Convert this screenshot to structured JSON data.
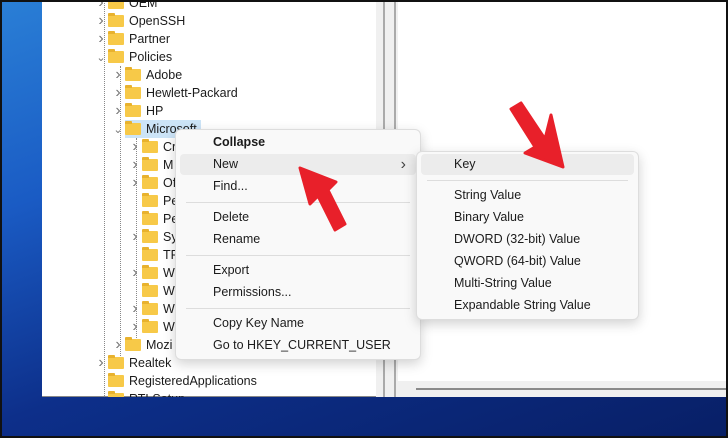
{
  "tree": [
    {
      "label": "OEM",
      "level": 0,
      "state": "collapsed"
    },
    {
      "label": "OpenSSH",
      "level": 0,
      "state": "collapsed"
    },
    {
      "label": "Partner",
      "level": 0,
      "state": "collapsed"
    },
    {
      "label": "Policies",
      "level": 0,
      "state": "expanded"
    },
    {
      "label": "Adobe",
      "level": 1,
      "state": "collapsed"
    },
    {
      "label": "Hewlett-Packard",
      "level": 1,
      "state": "collapsed"
    },
    {
      "label": "HP",
      "level": 1,
      "state": "collapsed"
    },
    {
      "label": "Microsoft",
      "level": 1,
      "state": "expanded",
      "selected": true
    },
    {
      "label": "Cr",
      "level": 2,
      "state": "collapsed"
    },
    {
      "label": "M",
      "level": 2,
      "state": "collapsed"
    },
    {
      "label": "Of",
      "level": 2,
      "state": "collapsed"
    },
    {
      "label": "Pe",
      "level": 2,
      "state": "leaf"
    },
    {
      "label": "Pe",
      "level": 2,
      "state": "leaf"
    },
    {
      "label": "Sy",
      "level": 2,
      "state": "collapsed"
    },
    {
      "label": "TP",
      "level": 2,
      "state": "leaf"
    },
    {
      "label": "W",
      "level": 2,
      "state": "collapsed"
    },
    {
      "label": "W",
      "level": 2,
      "state": "leaf"
    },
    {
      "label": "W",
      "level": 2,
      "state": "collapsed"
    },
    {
      "label": "W",
      "level": 2,
      "state": "collapsed"
    },
    {
      "label": "Mozi",
      "level": 1,
      "state": "collapsed"
    },
    {
      "label": "Realtek",
      "level": 0,
      "state": "collapsed"
    },
    {
      "label": "RegisteredApplications",
      "level": 0,
      "state": "leaf"
    },
    {
      "label": "RTLSetup",
      "level": 0,
      "state": "leaf"
    }
  ],
  "context_menu": {
    "items": [
      {
        "label": "Collapse",
        "bold": true
      },
      {
        "label": "New",
        "highlighted": true,
        "submenu": true
      },
      {
        "label": "Find..."
      },
      {
        "separator": true
      },
      {
        "label": "Delete"
      },
      {
        "label": "Rename"
      },
      {
        "separator": true
      },
      {
        "label": "Export"
      },
      {
        "label": "Permissions..."
      },
      {
        "separator": true
      },
      {
        "label": "Copy Key Name"
      },
      {
        "label": "Go to HKEY_CURRENT_USER"
      }
    ]
  },
  "submenu": {
    "items": [
      {
        "label": "Key",
        "highlighted": true
      },
      {
        "separator": true
      },
      {
        "label": "String Value"
      },
      {
        "label": "Binary Value"
      },
      {
        "label": "DWORD (32-bit) Value"
      },
      {
        "label": "QWORD (64-bit) Value"
      },
      {
        "label": "Multi-String Value"
      },
      {
        "label": "Expandable String Value"
      }
    ]
  },
  "colors": {
    "annotation_arrow": "#e8202a",
    "folder": "#f7c948",
    "selection": "#cce4f7"
  }
}
